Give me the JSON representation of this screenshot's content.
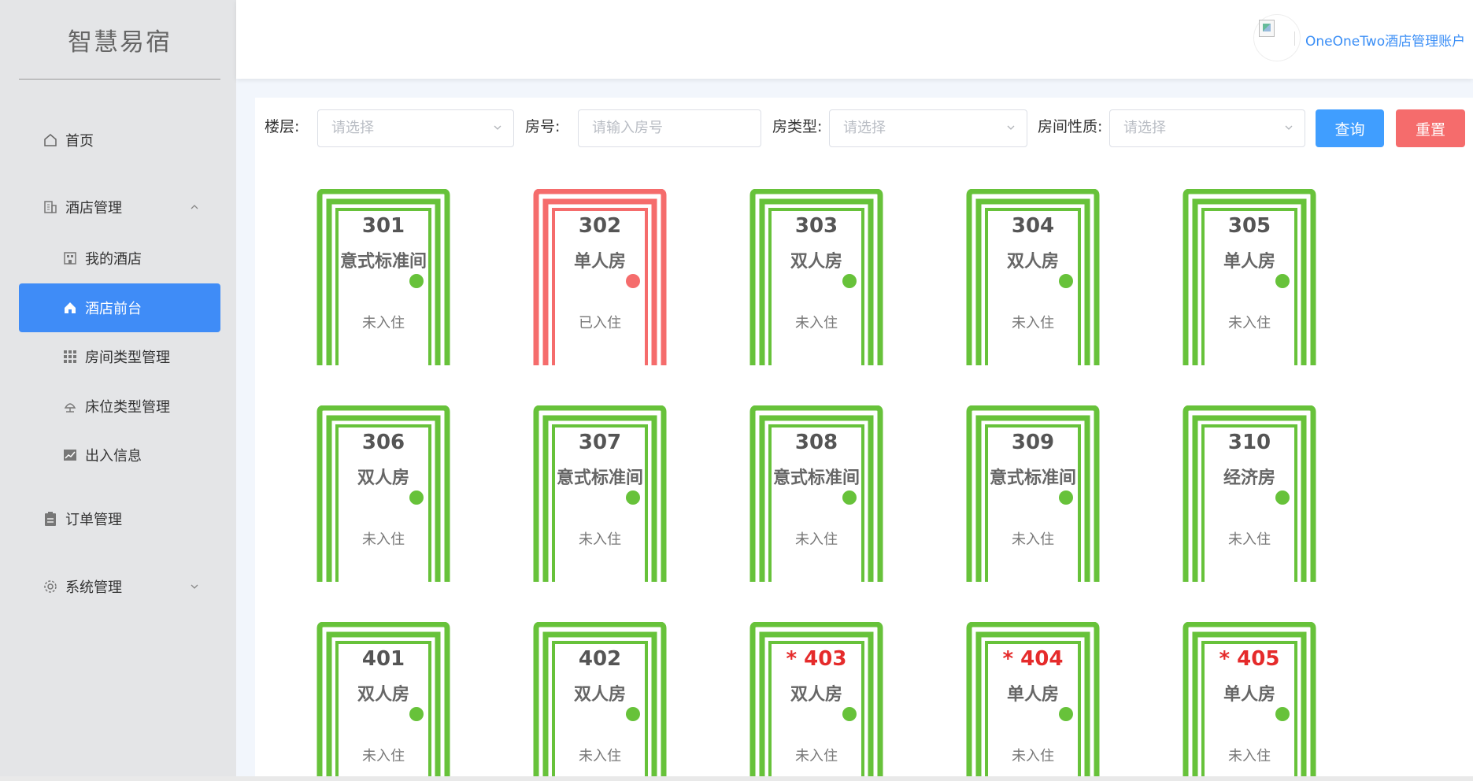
{
  "app": {
    "brand": "智慧易宿",
    "account_name": "OneOneTwo酒店管理账户"
  },
  "sidebar": {
    "items": [
      {
        "label": "首页",
        "icon": "home-outline-icon",
        "level": "top"
      },
      {
        "label": "酒店管理",
        "icon": "building-icon",
        "level": "top",
        "expanded": true
      },
      {
        "label": "我的酒店",
        "icon": "office-icon",
        "level": "sub"
      },
      {
        "label": "酒店前台",
        "icon": "home-filled-icon",
        "level": "sub",
        "active": true
      },
      {
        "label": "房间类型管理",
        "icon": "grid-icon",
        "level": "sub"
      },
      {
        "label": "床位类型管理",
        "icon": "lamp-icon",
        "level": "sub"
      },
      {
        "label": "出入信息",
        "icon": "chart-icon",
        "level": "sub"
      },
      {
        "label": "订单管理",
        "icon": "document-icon",
        "level": "top"
      },
      {
        "label": "系统管理",
        "icon": "gear-icon",
        "level": "top",
        "expanded": false
      }
    ]
  },
  "filters": {
    "floor_label": "楼层:",
    "floor_placeholder": "请选择",
    "room_no_label": "房号:",
    "room_no_placeholder": "请输入房号",
    "room_type_label": "房类型:",
    "room_type_placeholder": "请选择",
    "room_nature_label": "房间性质:",
    "room_nature_placeholder": "请选择",
    "query_button": "查询",
    "reset_button": "重置"
  },
  "colors": {
    "vacant": "#67c23a",
    "occupied": "#f56c6c",
    "accent": "#409eff",
    "vip_number": "#e52b2b"
  },
  "rooms": [
    {
      "number": "301",
      "type": "意式标准间",
      "status": "未入住",
      "occupied": false,
      "vip": false
    },
    {
      "number": "302",
      "type": "单人房",
      "status": "已入住",
      "occupied": true,
      "vip": false
    },
    {
      "number": "303",
      "type": "双人房",
      "status": "未入住",
      "occupied": false,
      "vip": false
    },
    {
      "number": "304",
      "type": "双人房",
      "status": "未入住",
      "occupied": false,
      "vip": false
    },
    {
      "number": "305",
      "type": "单人房",
      "status": "未入住",
      "occupied": false,
      "vip": false
    },
    {
      "number": "306",
      "type": "双人房",
      "status": "未入住",
      "occupied": false,
      "vip": false
    },
    {
      "number": "307",
      "type": "意式标准间",
      "status": "未入住",
      "occupied": false,
      "vip": false
    },
    {
      "number": "308",
      "type": "意式标准间",
      "status": "未入住",
      "occupied": false,
      "vip": false
    },
    {
      "number": "309",
      "type": "意式标准间",
      "status": "未入住",
      "occupied": false,
      "vip": false
    },
    {
      "number": "310",
      "type": "经济房",
      "status": "未入住",
      "occupied": false,
      "vip": false
    },
    {
      "number": "401",
      "type": "双人房",
      "status": "未入住",
      "occupied": false,
      "vip": false
    },
    {
      "number": "402",
      "type": "双人房",
      "status": "未入住",
      "occupied": false,
      "vip": false
    },
    {
      "number": "* 403",
      "type": "双人房",
      "status": "未入住",
      "occupied": false,
      "vip": true
    },
    {
      "number": "* 404",
      "type": "单人房",
      "status": "未入住",
      "occupied": false,
      "vip": true
    },
    {
      "number": "* 405",
      "type": "单人房",
      "status": "未入住",
      "occupied": false,
      "vip": true
    }
  ]
}
